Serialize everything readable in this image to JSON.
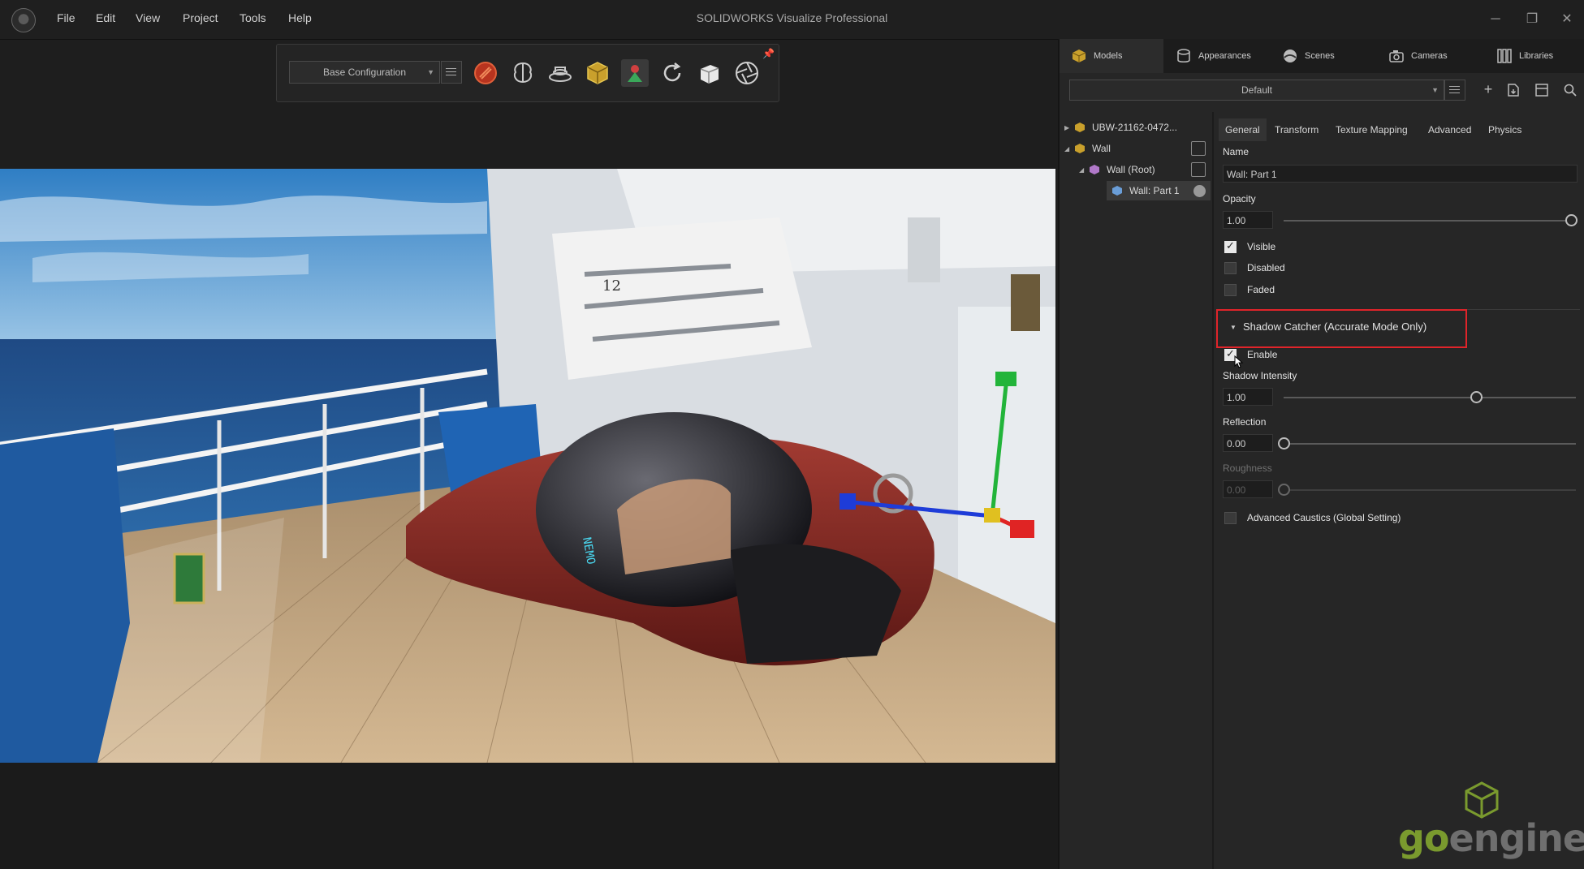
{
  "app": {
    "title": "SOLIDWORKS Visualize Professional",
    "menu": [
      "File",
      "Edit",
      "View",
      "Project",
      "Tools",
      "Help"
    ],
    "window_controls": [
      "minimize",
      "restore",
      "close"
    ]
  },
  "toolbar": {
    "configuration": "Base Configuration",
    "tools": [
      "render-mode-icon",
      "brain-ai-icon",
      "turntable-icon",
      "box-object-icon",
      "scene-tool-icon",
      "refresh-icon",
      "cube-transform-icon",
      "aperture-icon"
    ],
    "active_tool_index": 4
  },
  "panel": {
    "tabs": [
      {
        "label": "Models",
        "icon": "models-cube-icon",
        "active": true
      },
      {
        "label": "Appearances",
        "icon": "appearances-icon",
        "active": false
      },
      {
        "label": "Scenes",
        "icon": "scenes-icon",
        "active": false
      },
      {
        "label": "Cameras",
        "icon": "camera-icon",
        "active": false
      },
      {
        "label": "Libraries",
        "icon": "libraries-icon",
        "active": false
      }
    ],
    "preset": "Default",
    "tree": [
      {
        "label": "UBW-21162-0472...",
        "level": 0,
        "expanded": false
      },
      {
        "label": "Wall",
        "level": 0,
        "expanded": true
      },
      {
        "label": "Wall (Root)",
        "level": 1,
        "expanded": true
      },
      {
        "label": "Wall: Part 1",
        "level": 2,
        "selected": true
      }
    ],
    "subtabs": [
      "General",
      "Transform",
      "Texture Mapping",
      "Advanced",
      "Physics"
    ],
    "active_subtab": "General",
    "general": {
      "name_label": "Name",
      "name_value": "Wall: Part 1",
      "opacity_label": "Opacity",
      "opacity_value": "1.00",
      "opacity_level": 1.0,
      "visible_label": "Visible",
      "visible_checked": true,
      "disabled_label": "Disabled",
      "disabled_checked": false,
      "faded_label": "Faded",
      "faded_checked": false
    },
    "shadow_catcher": {
      "header": "Shadow Catcher (Accurate Mode Only)",
      "enable_label": "Enable",
      "enable_checked": true,
      "intensity_label": "Shadow Intensity",
      "intensity_value": "1.00",
      "intensity_level": 0.66,
      "reflection_label": "Reflection",
      "reflection_value": "0.00",
      "reflection_level": 0.0,
      "roughness_label": "Roughness",
      "roughness_value": "0.00",
      "roughness_level": 0.0,
      "caustics_label": "Advanced Caustics (Global Setting)",
      "caustics_checked": false
    }
  },
  "viewport": {
    "scene": "submarine-on-cruise-ship-deck",
    "sub_label": "NEMO",
    "deck_number": "12"
  },
  "brand": {
    "text_go": "go",
    "text_engineer": "engineer",
    "colors": {
      "go": "#7a9a2e",
      "engineer": "#6f6f6f"
    }
  },
  "colors": {
    "panel_bg": "#262626",
    "highlight": "#e0242a",
    "gizmo_x": "#e02424",
    "gizmo_y": "#22b43a",
    "gizmo_z": "#1e3cd8"
  }
}
